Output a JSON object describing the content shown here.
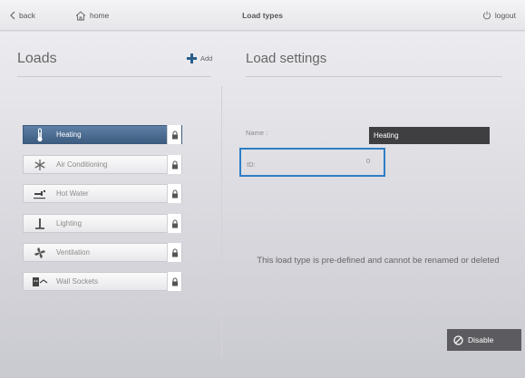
{
  "header": {
    "back_label": "back",
    "home_label": "home",
    "title": "Load types",
    "logout_label": "logout"
  },
  "loads_panel": {
    "heading": "Loads",
    "add_label": "Add",
    "items": [
      {
        "label": "Heating",
        "icon": "thermometer-icon",
        "selected": true,
        "locked": true
      },
      {
        "label": "Air Conditioning",
        "icon": "snowflake-icon",
        "selected": false,
        "locked": true
      },
      {
        "label": "Hot Water",
        "icon": "faucet-icon",
        "selected": false,
        "locked": true
      },
      {
        "label": "Lighting",
        "icon": "lamp-icon",
        "selected": false,
        "locked": true
      },
      {
        "label": "Ventilation",
        "icon": "fan-icon",
        "selected": false,
        "locked": true
      },
      {
        "label": "Wall Sockets",
        "icon": "socket-icon",
        "selected": false,
        "locked": true
      }
    ]
  },
  "settings": {
    "heading": "Load settings",
    "name_label": "Name :",
    "name_value": "Heating",
    "id_label": "ID:",
    "id_value": "0",
    "notice": "This load type is pre-defined and cannot be renamed or deleted",
    "disable_label": "Disable"
  },
  "colors": {
    "accent": "#4a6d94",
    "highlight_border": "#2f7ec6",
    "name_field_bg": "#3f3f42",
    "disable_button_bg": "#5c5c60"
  }
}
